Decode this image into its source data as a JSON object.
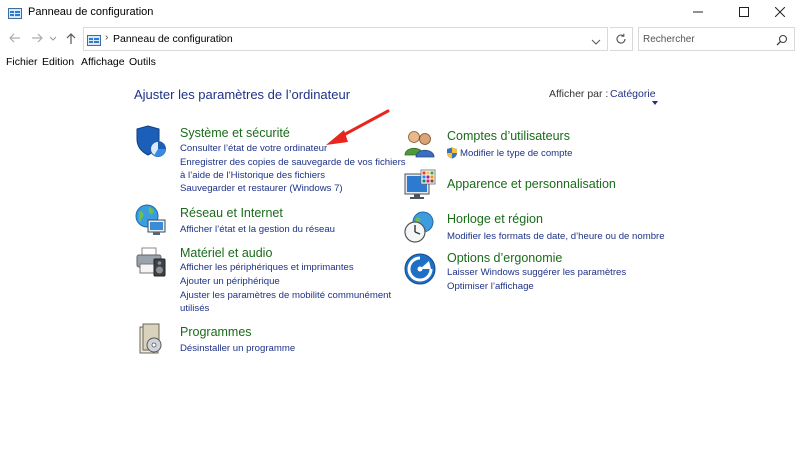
{
  "window": {
    "title": "Panneau de configuration"
  },
  "address": {
    "breadcrumb": "Panneau de configuration",
    "search_placeholder": "Rechercher"
  },
  "menu": {
    "items": [
      "Fichier",
      "Edition",
      "Affichage",
      "Outils"
    ]
  },
  "main": {
    "heading": "Ajuster les paramètres de l’ordinateur",
    "view_by_label": "Afficher par :",
    "view_by_value": "Catégorie"
  },
  "categories": {
    "system": {
      "title": "Système et sécurité",
      "links": [
        "Consulter l’état de votre ordinateur",
        "Enregistrer des copies de sauvegarde de vos fichiers",
        "à l’aide de l’Historique des fichiers",
        "Sauvegarder et restaurer (Windows 7)"
      ]
    },
    "network": {
      "title": "Réseau et Internet",
      "links": [
        "Afficher l’état et la gestion du réseau"
      ]
    },
    "hardware": {
      "title": "Matériel et audio",
      "links": [
        "Afficher les périphériques et imprimantes",
        "Ajouter un périphérique",
        "Ajuster les paramètres de mobilité communément",
        "utilisés"
      ]
    },
    "programs": {
      "title": "Programmes",
      "links": [
        "Désinstaller un programme"
      ]
    },
    "accounts": {
      "title": "Comptes d’utilisateurs",
      "links": [
        "Modifier le type de compte"
      ]
    },
    "appearance": {
      "title": "Apparence et personnalisation"
    },
    "clock": {
      "title": "Horloge et région",
      "links": [
        "Modifier les formats de date, d’heure ou de nombre"
      ]
    },
    "ease": {
      "title": "Options d’ergonomie",
      "links": [
        "Laisser Windows suggérer les paramètres",
        "Optimiser l’affichage"
      ]
    }
  },
  "colors": {
    "category_title": "#1a6b1a",
    "link": "#1e3287",
    "annotation_arrow": "#e8261e"
  }
}
